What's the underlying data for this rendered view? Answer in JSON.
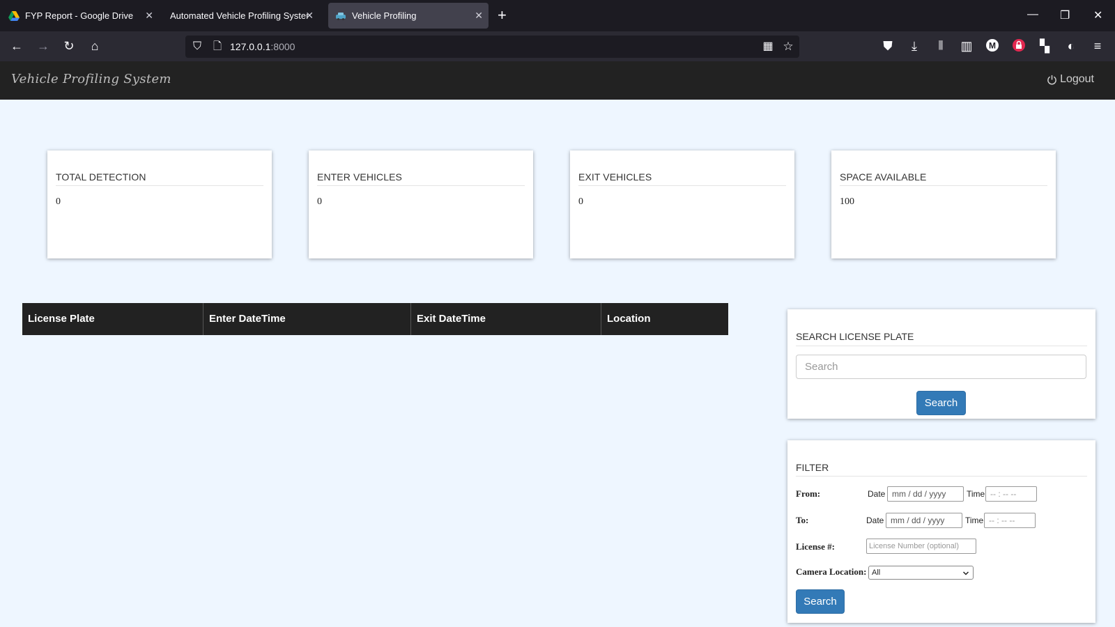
{
  "browser": {
    "tabs": [
      {
        "title": "FYP Report - Google Drive"
      },
      {
        "title": "Automated Vehicle Profiling System"
      },
      {
        "title": "Vehicle Profiling"
      }
    ],
    "url": {
      "host": "127.0.0.1",
      "port": ":8000"
    }
  },
  "app": {
    "brand": "Vehicle Profiling System",
    "logout_label": "Logout"
  },
  "stats": [
    {
      "title": "TOTAL DETECTION",
      "value": "0"
    },
    {
      "title": "ENTER VEHICLES",
      "value": "0"
    },
    {
      "title": "EXIT VEHICLES",
      "value": "0"
    },
    {
      "title": "SPACE AVAILABLE",
      "value": "100"
    }
  ],
  "table": {
    "columns": [
      "License Plate",
      "Enter DateTime",
      "Exit DateTime",
      "Location"
    ],
    "rows": []
  },
  "search_panel": {
    "title": "SEARCH LICENSE PLATE",
    "placeholder": "Search",
    "button": "Search"
  },
  "filter_panel": {
    "title": "FILTER",
    "from_label": "From:",
    "to_label": "To:",
    "date_label": "Date",
    "time_label": "Time",
    "date_placeholder": "mm / dd / yyyy",
    "time_placeholder": "-- : --  --",
    "license_label": "License #:",
    "license_placeholder": "License Number (optional)",
    "camera_label": "Camera Location:",
    "camera_selected": "All",
    "button": "Search"
  }
}
